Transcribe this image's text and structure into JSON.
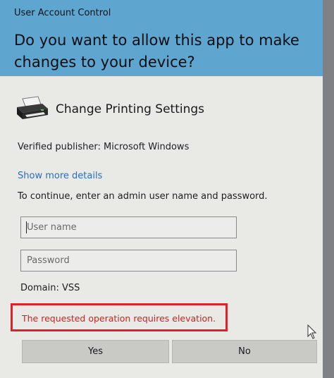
{
  "window": {
    "title": "User Account Control"
  },
  "prompt": {
    "question": "Do you want to allow this app to make changes to your device?"
  },
  "app": {
    "icon": "printer-icon",
    "name": "Change Printing Settings",
    "publisher": "Verified publisher: Microsoft Windows"
  },
  "links": {
    "show_more": "Show more details"
  },
  "credentials": {
    "instruction": "To continue, enter an admin user name and password.",
    "username_placeholder": "User name",
    "username_value": "",
    "password_placeholder": "Password",
    "password_value": "",
    "domain": "Domain: VSS"
  },
  "error": {
    "message": "The requested operation requires elevation."
  },
  "buttons": {
    "yes": "Yes",
    "no": "No"
  },
  "colors": {
    "header": "#5ea6cf",
    "link": "#2a6fb8",
    "error": "#d21e1e",
    "error_highlight": "#e0212a"
  }
}
